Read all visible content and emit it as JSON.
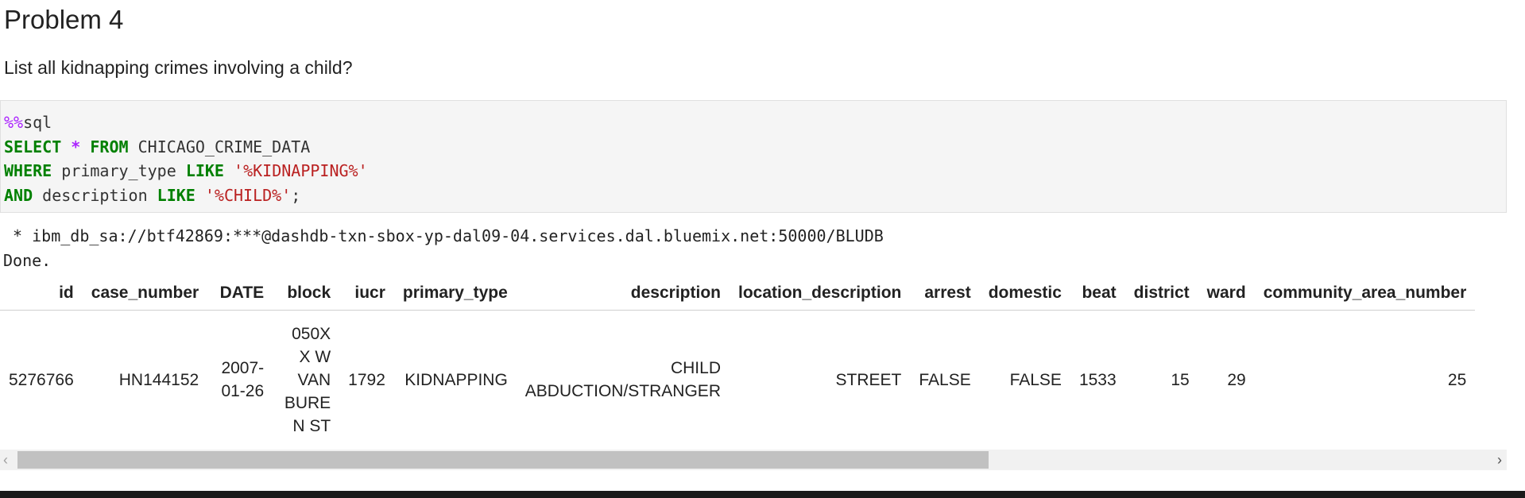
{
  "heading": "Problem 4",
  "question": "List all kidnapping crimes involving a child?",
  "code": {
    "magic_prefix": "%%",
    "magic_name": "sql",
    "line2": {
      "kw1": "SELECT",
      "op": "*",
      "kw2": "FROM",
      "table": "CHICAGO_CRIME_DATA"
    },
    "line3": {
      "kw1": "WHERE",
      "col": "primary_type",
      "kw2": "LIKE",
      "str": "'%KIDNAPPING%'"
    },
    "line4": {
      "kw1": "AND",
      "col": "description",
      "kw2": "LIKE",
      "str": "'%CHILD%'",
      "end": ";"
    }
  },
  "output": {
    "connection": " * ibm_db_sa://btf42869:***@dashdb-txn-sbox-yp-dal09-04.services.dal.bluemix.net:50000/BLUDB",
    "status": "Done."
  },
  "table": {
    "headers": [
      "id",
      "case_number",
      "DATE",
      "block",
      "iucr",
      "primary_type",
      "description",
      "location_description",
      "arrest",
      "domestic",
      "beat",
      "district",
      "ward",
      "community_area_number"
    ],
    "rows": [
      [
        "5276766",
        "HN144152",
        "2007-01-26",
        "050XX W VAN BUREN ST",
        "1792",
        "KIDNAPPING",
        "CHILD ABDUCTION/STRANGER",
        "STREET",
        "FALSE",
        "FALSE",
        "1533",
        "15",
        "29",
        "25"
      ]
    ]
  },
  "scrollbar": {
    "left_arrow": "‹",
    "right_arrow": "›"
  }
}
